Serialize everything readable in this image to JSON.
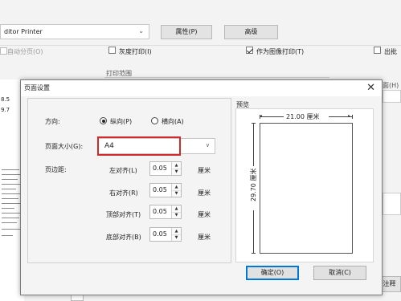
{
  "background": {
    "printer_name": "ditor Printer",
    "properties_button": "属性(P)",
    "advanced_button": "高级",
    "auto_paging": "自动分页(O)",
    "grayscale": "灰度打印(I)",
    "print_as_image": "作为图像打印(T)",
    "output_label": "出批",
    "print_range": "打印范围",
    "range_right": "面(H)",
    "left_numbers": [
      "8.5",
      "9.7"
    ],
    "bottom_label": "注释"
  },
  "dialog": {
    "title": "页面设置",
    "orientation_label": "方向:",
    "portrait": "纵向(P)",
    "landscape": "横向(A)",
    "page_size_label": "页面大小(G):",
    "page_size_value": "A4",
    "margins_label": "页边距:",
    "margins": [
      {
        "label": "左对齐(L)",
        "value": "0.05",
        "unit": "厘米"
      },
      {
        "label": "右对齐(R)",
        "value": "0.05",
        "unit": "厘米"
      },
      {
        "label": "顶部对齐(T)",
        "value": "0.05",
        "unit": "厘米"
      },
      {
        "label": "底部对齐(B)",
        "value": "0.05",
        "unit": "厘米"
      }
    ],
    "preview_label": "预览",
    "preview_width": "21.00 厘米",
    "preview_height": "29.70 厘米",
    "ok_button": "确定(O)",
    "cancel_button": "取消(C)"
  },
  "colors": {
    "highlight": "#d22a2a",
    "primary_border": "#0078d7"
  }
}
